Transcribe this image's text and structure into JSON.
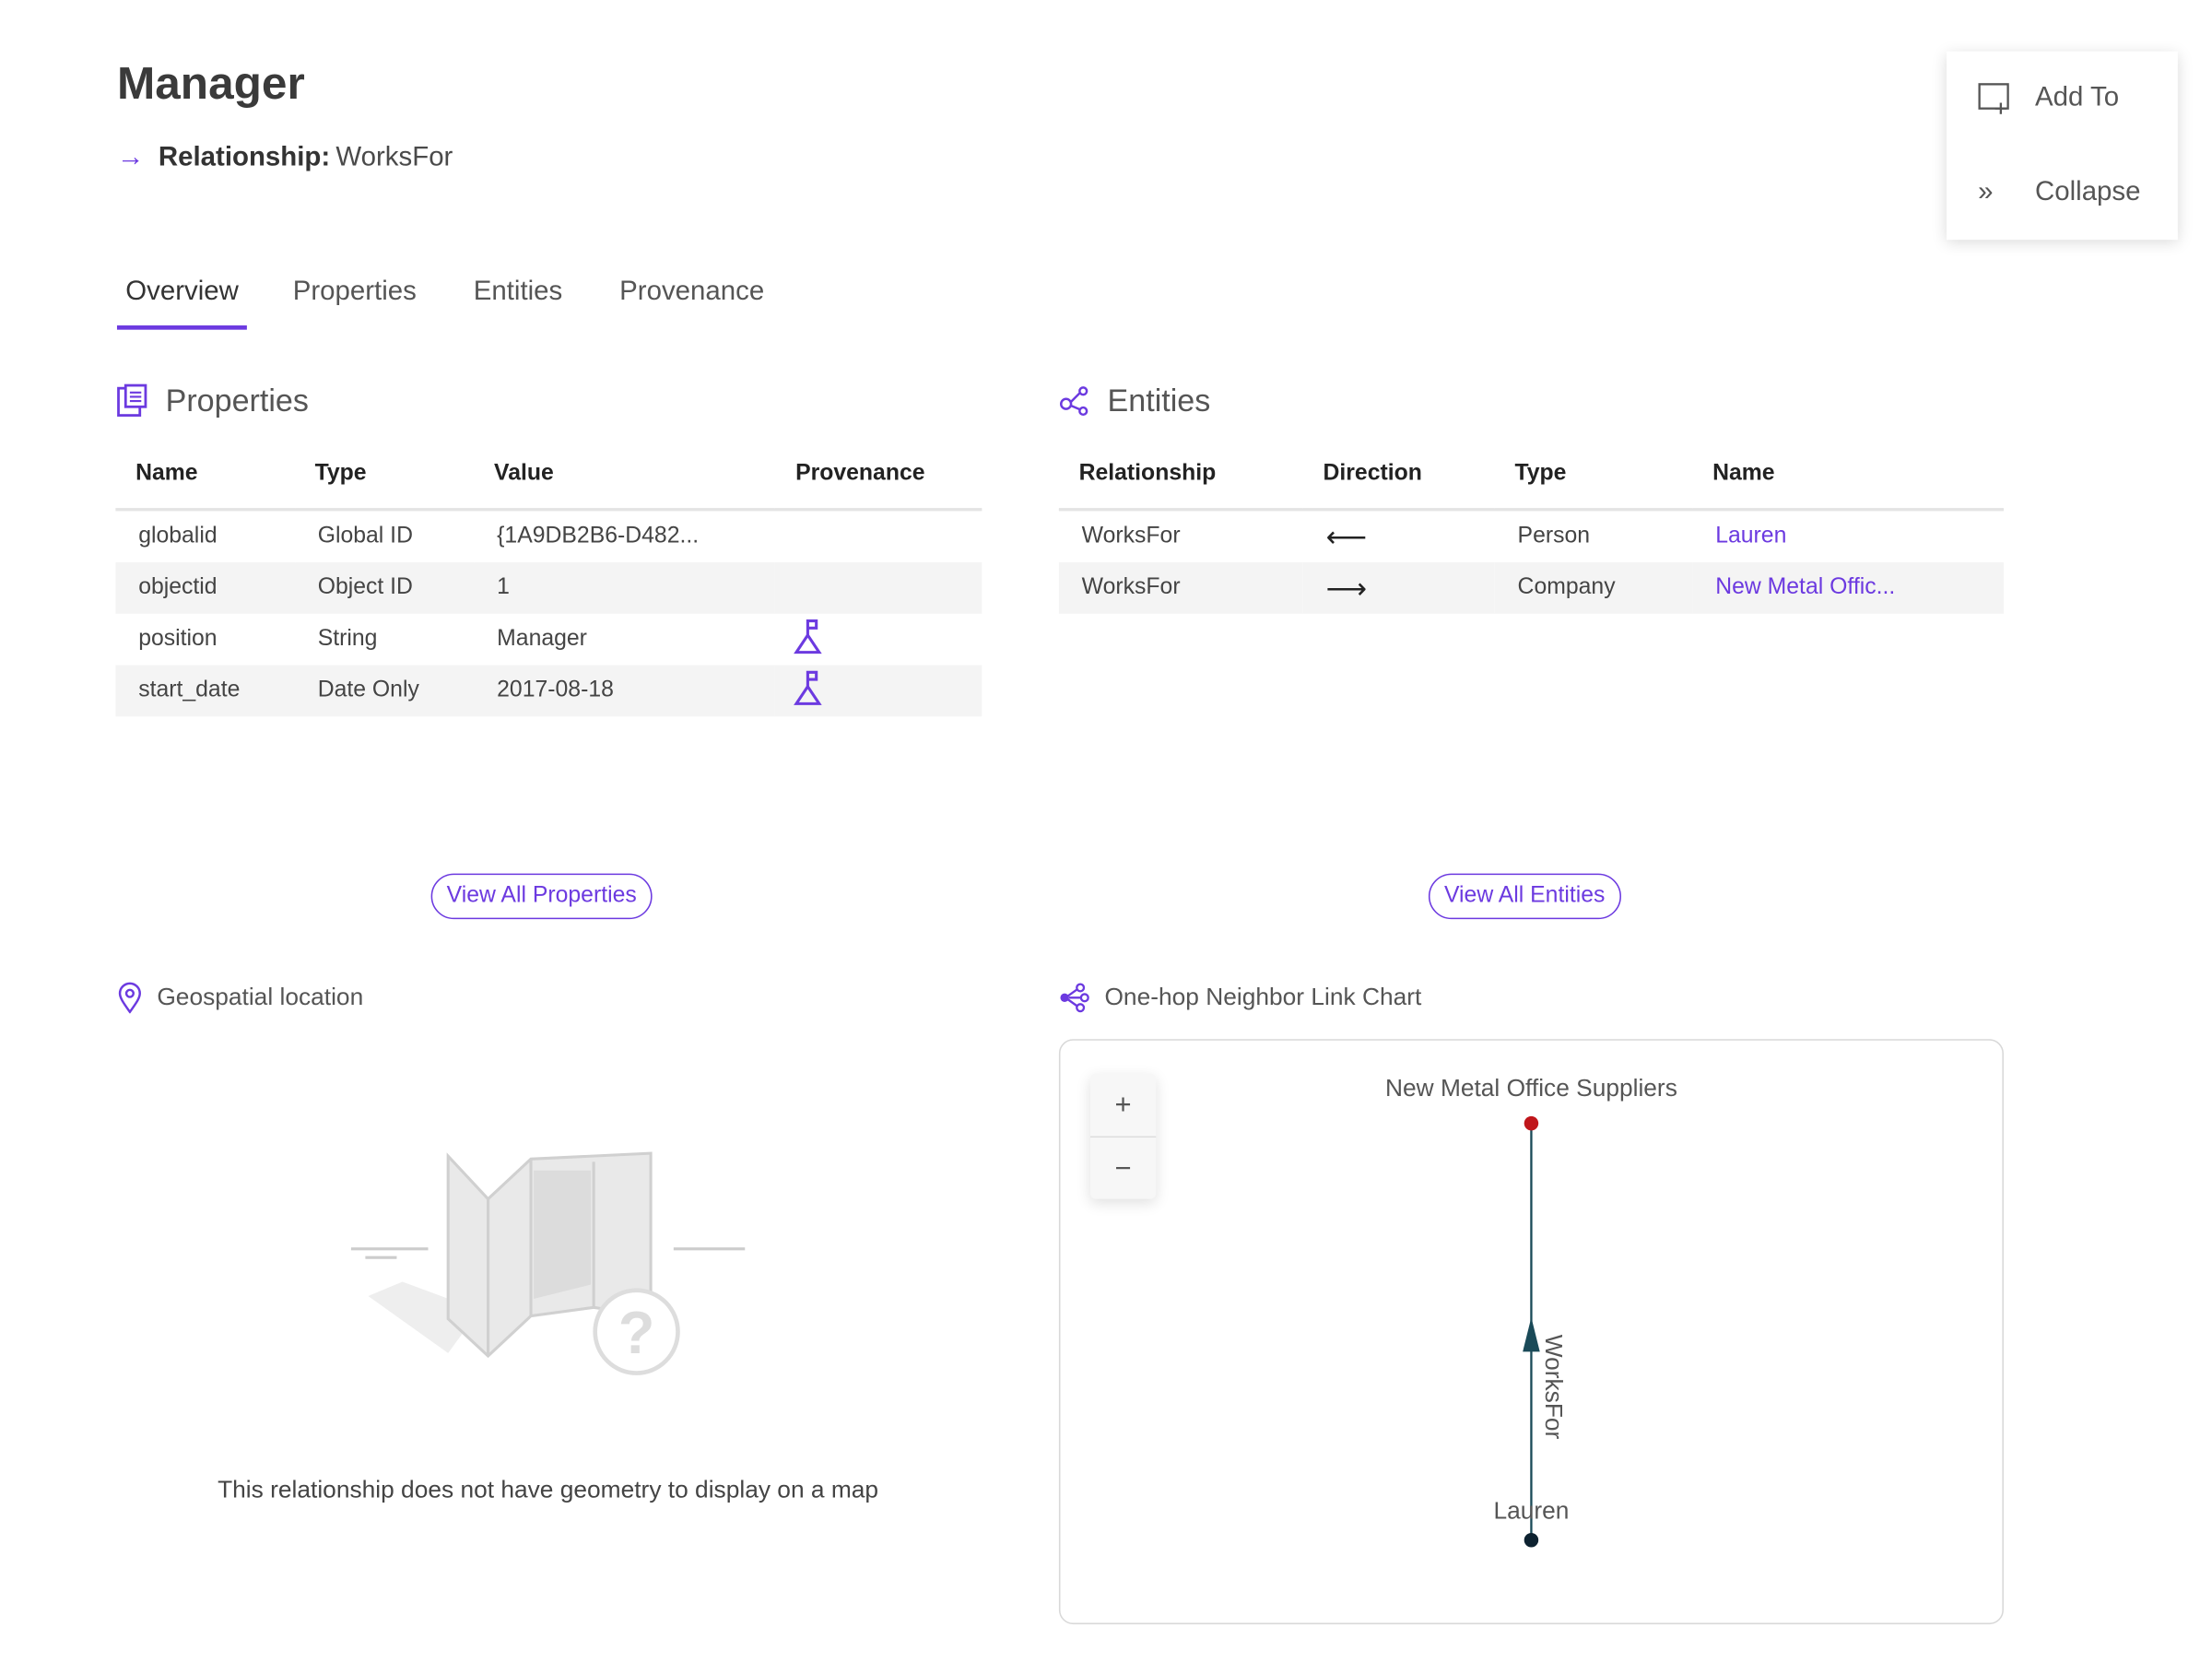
{
  "header": {
    "title": "Manager",
    "relationship_label": "Relationship:",
    "relationship_value": "WorksFor"
  },
  "side_menu": {
    "add_to": "Add To",
    "collapse": "Collapse"
  },
  "tabs": [
    {
      "label": "Overview",
      "active": true
    },
    {
      "label": "Properties"
    },
    {
      "label": "Entities"
    },
    {
      "label": "Provenance"
    }
  ],
  "properties": {
    "title": "Properties",
    "columns": [
      "Name",
      "Type",
      "Value",
      "Provenance"
    ],
    "rows": [
      {
        "name": "globalid",
        "type": "Global ID",
        "value": "{1A9DB2B6-D482...",
        "provenance": false
      },
      {
        "name": "objectid",
        "type": "Object ID",
        "value": "1",
        "provenance": false
      },
      {
        "name": "position",
        "type": "String",
        "value": "Manager",
        "provenance": true
      },
      {
        "name": "start_date",
        "type": "Date Only",
        "value": "2017-08-18",
        "provenance": true
      }
    ],
    "view_all": "View All Properties"
  },
  "entities": {
    "title": "Entities",
    "columns": [
      "Relationship",
      "Direction",
      "Type",
      "Name"
    ],
    "rows": [
      {
        "relationship": "WorksFor",
        "direction": "⟵",
        "type": "Person",
        "name": "Lauren"
      },
      {
        "relationship": "WorksFor",
        "direction": "⟶",
        "type": "Company",
        "name": "New Metal Offic..."
      }
    ],
    "view_all": "View All Entities"
  },
  "geo": {
    "title": "Geospatial location",
    "message": "This relationship does not have geometry to display on a map"
  },
  "link_chart": {
    "title": "One-hop Neighbor Link Chart",
    "zoom_in": "+",
    "zoom_out": "−",
    "nodes": [
      {
        "label": "New Metal Office Suppliers",
        "color": "#c0161b"
      },
      {
        "label": "Lauren",
        "color": "#0d2230"
      }
    ],
    "edge": {
      "label": "WorksFor",
      "color": "#1a4a58",
      "from": "Lauren",
      "to": "New Metal Office Suppliers"
    }
  },
  "colors": {
    "accent": "#6c3ae0"
  }
}
